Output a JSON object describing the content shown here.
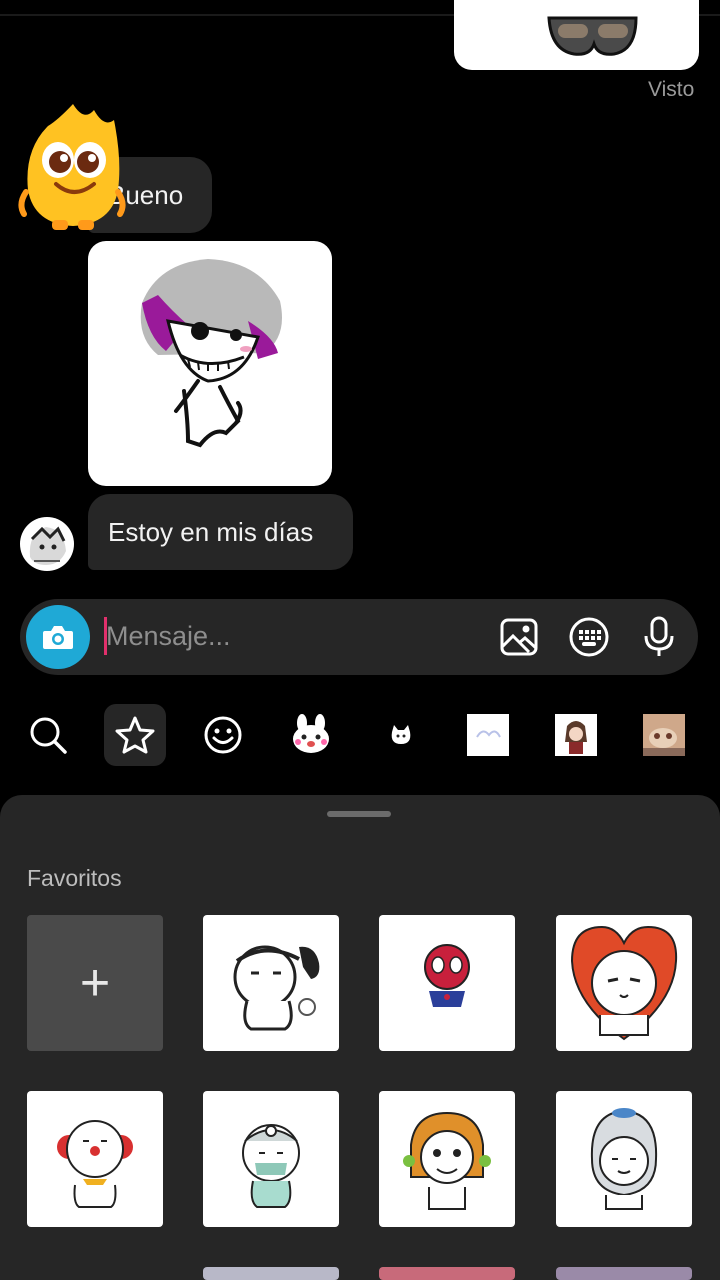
{
  "chat": {
    "seen_label": "Visto",
    "messages": [
      {
        "type": "text",
        "text": "Bueno"
      },
      {
        "type": "sticker",
        "description": "drawn character sticker"
      },
      {
        "type": "text",
        "text": "Estoy en mis días"
      }
    ]
  },
  "composer": {
    "placeholder": "Mensaje...",
    "camera_icon": "camera-icon",
    "gallery_icon": "image-icon",
    "sticker_icon": "sticker-icon",
    "mic_icon": "microphone-icon"
  },
  "tray": {
    "icons": [
      "search-icon",
      "star-icon",
      "emoji-icon",
      "sticker-pack-1",
      "sticker-pack-2",
      "sticker-pack-3",
      "sticker-pack-4",
      "sticker-pack-5"
    ],
    "selected": "star-icon"
  },
  "favorites": {
    "title": "Favoritos",
    "add_label": "+",
    "stickers": [
      "sticker-1",
      "sticker-2",
      "sticker-3",
      "sticker-4",
      "sticker-5",
      "sticker-6",
      "sticker-7"
    ]
  },
  "colors": {
    "background": "#000000",
    "bubble": "#262626",
    "accent_camera": "#1fa9d6",
    "caret": "#e1306c",
    "sheet": "#262626"
  }
}
